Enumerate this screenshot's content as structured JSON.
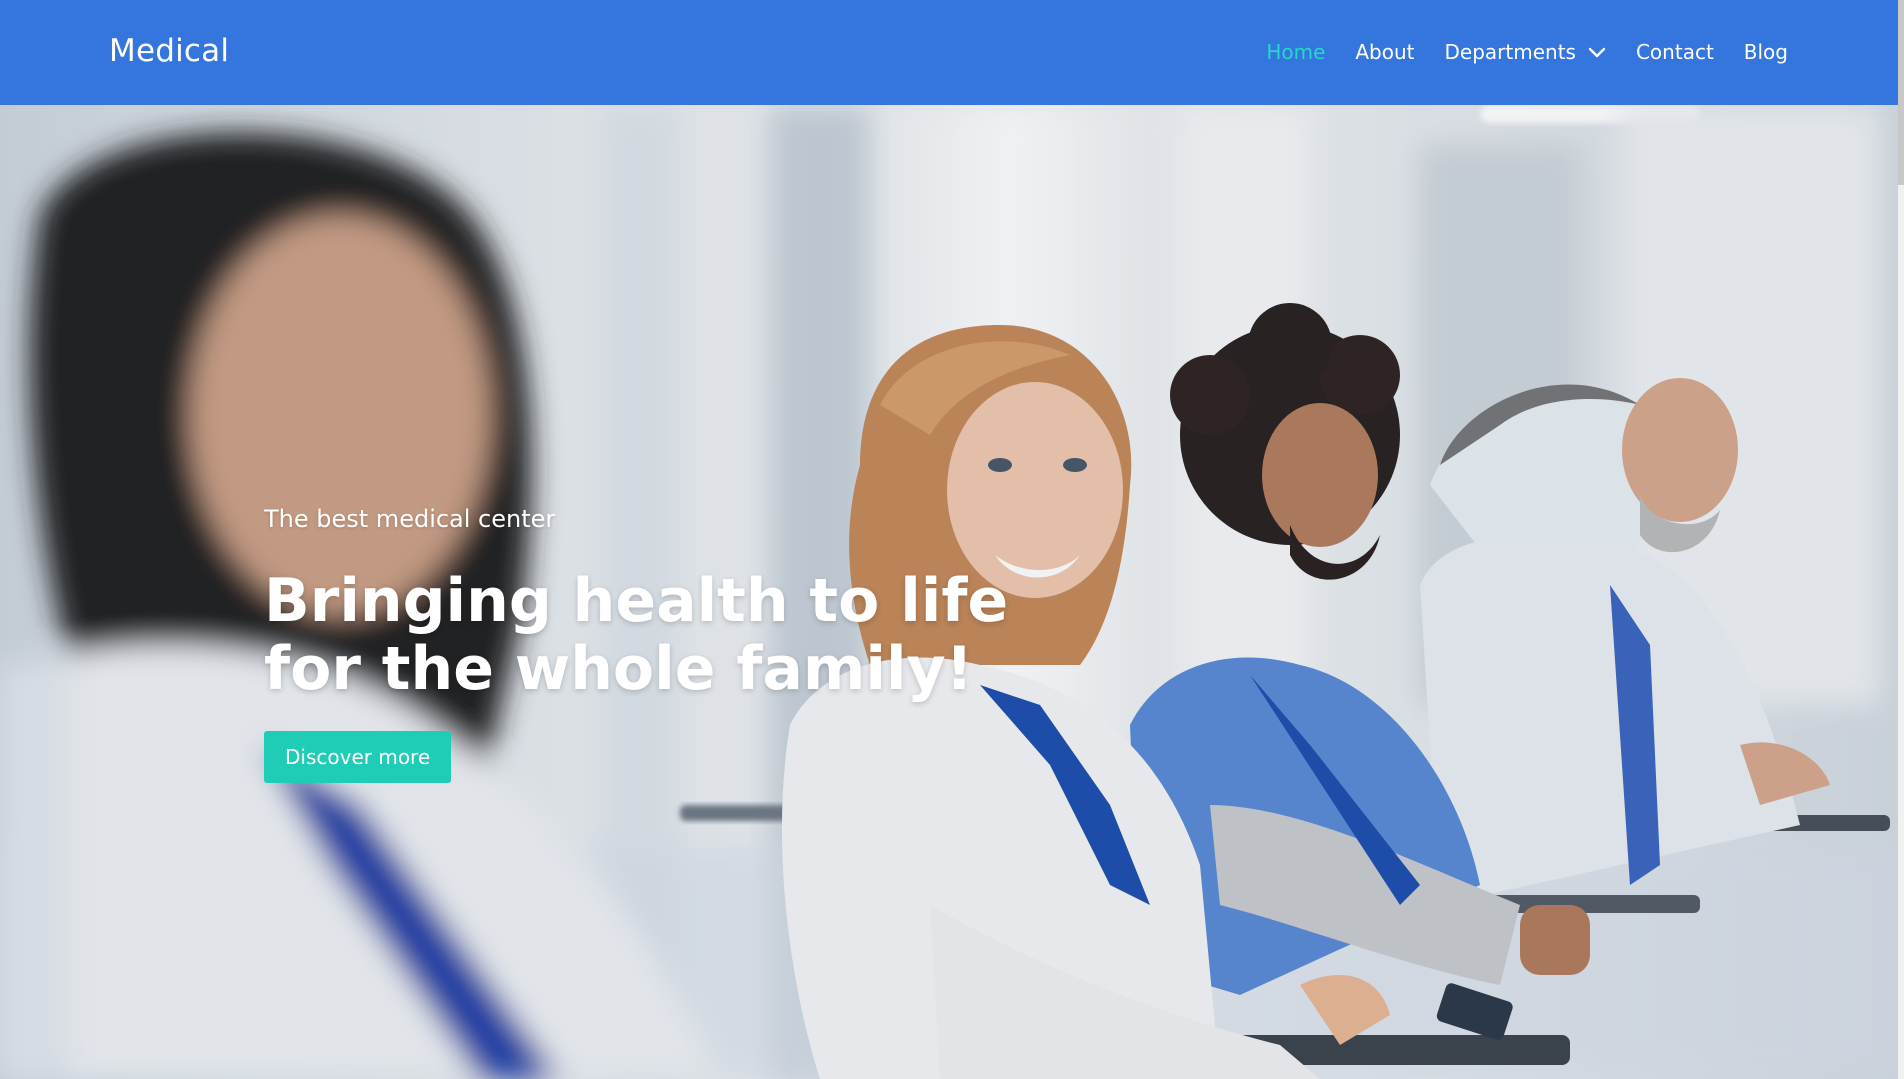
{
  "brand": "Medical",
  "nav": {
    "items": [
      {
        "label": "Home",
        "active": true
      },
      {
        "label": "About",
        "active": false
      },
      {
        "label": "Departments",
        "active": false,
        "has_dropdown": true
      },
      {
        "label": "Contact",
        "active": false
      },
      {
        "label": "Blog",
        "active": false
      }
    ]
  },
  "hero": {
    "kicker": "The best medical center",
    "title_line1": "Bringing health to life",
    "title_line2": "for the whole family!",
    "button_label": "Discover more",
    "image_icon": "doctors-seminar-photo"
  },
  "colors": {
    "navbar_bg": "#3575de",
    "nav_active": "#25d8c8",
    "button_bg": "#1fcdb7",
    "text": "#ffffff"
  }
}
